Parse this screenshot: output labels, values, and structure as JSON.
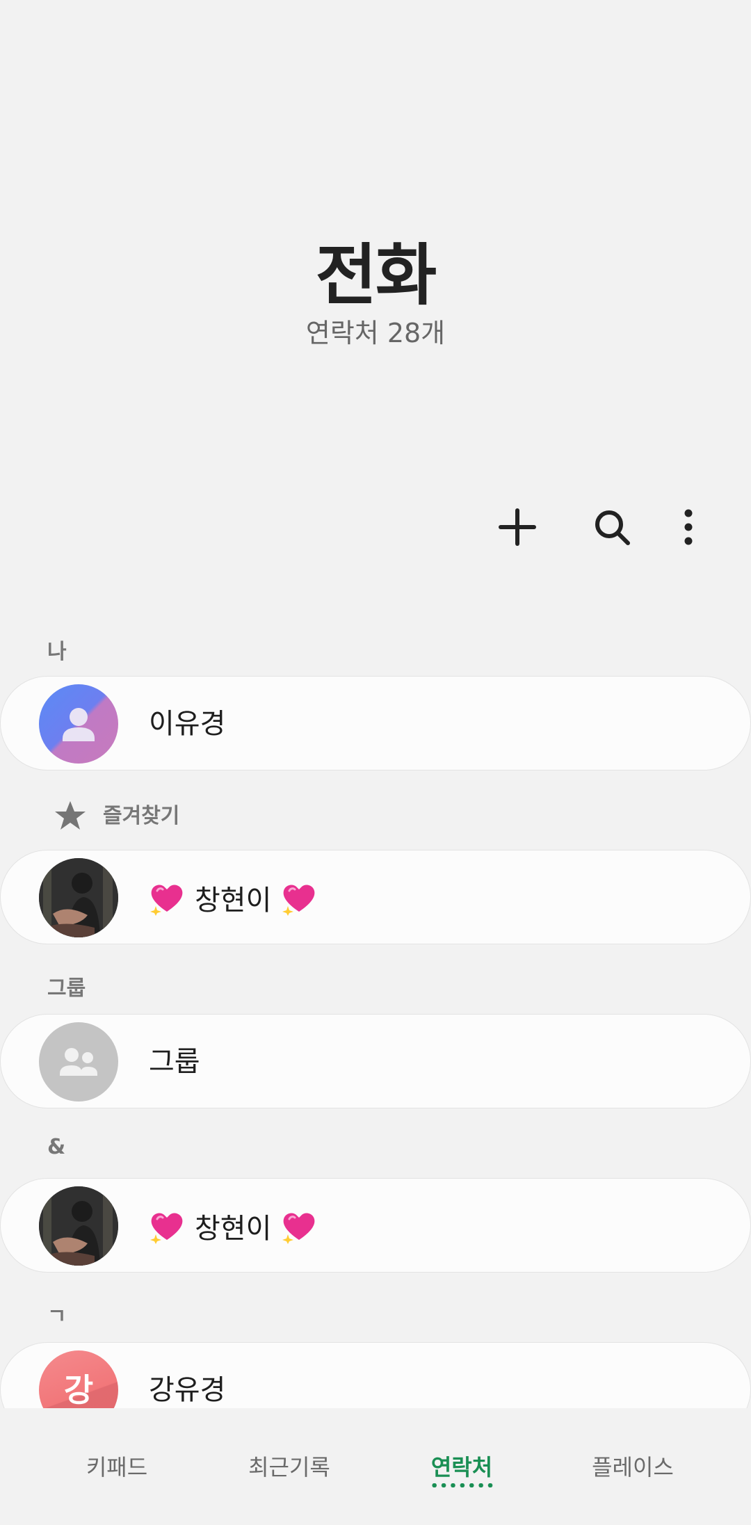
{
  "header": {
    "title": "전화",
    "subtitle": "연락처 28개"
  },
  "toolbar": {
    "add_icon": "plus-icon",
    "search_icon": "search-icon",
    "more_icon": "more-vertical-icon"
  },
  "sections": {
    "me": {
      "label": "나",
      "contact": {
        "name": "이유경",
        "avatar": "person-icon"
      }
    },
    "favorites": {
      "label": "즐겨찾기",
      "icon": "star-icon",
      "contact": {
        "name": "창현이",
        "emoji": "sparkling-heart"
      }
    },
    "groups": {
      "label": "그룹",
      "item": {
        "name": "그룹",
        "avatar": "group-icon"
      }
    },
    "amp": {
      "label": "&",
      "contact": {
        "name": "창현이",
        "emoji": "sparkling-heart"
      }
    },
    "giyeok": {
      "label": "ㄱ",
      "contact": {
        "name": "강유경",
        "initial": "강"
      }
    }
  },
  "bottom_nav": {
    "items": [
      {
        "label": "키패드"
      },
      {
        "label": "최근기록"
      },
      {
        "label": "연락처",
        "active": true
      },
      {
        "label": "플레이스"
      }
    ]
  },
  "colors": {
    "accent": "#1a8f54",
    "background": "#f2f2f2",
    "card": "#fcfcfc"
  }
}
